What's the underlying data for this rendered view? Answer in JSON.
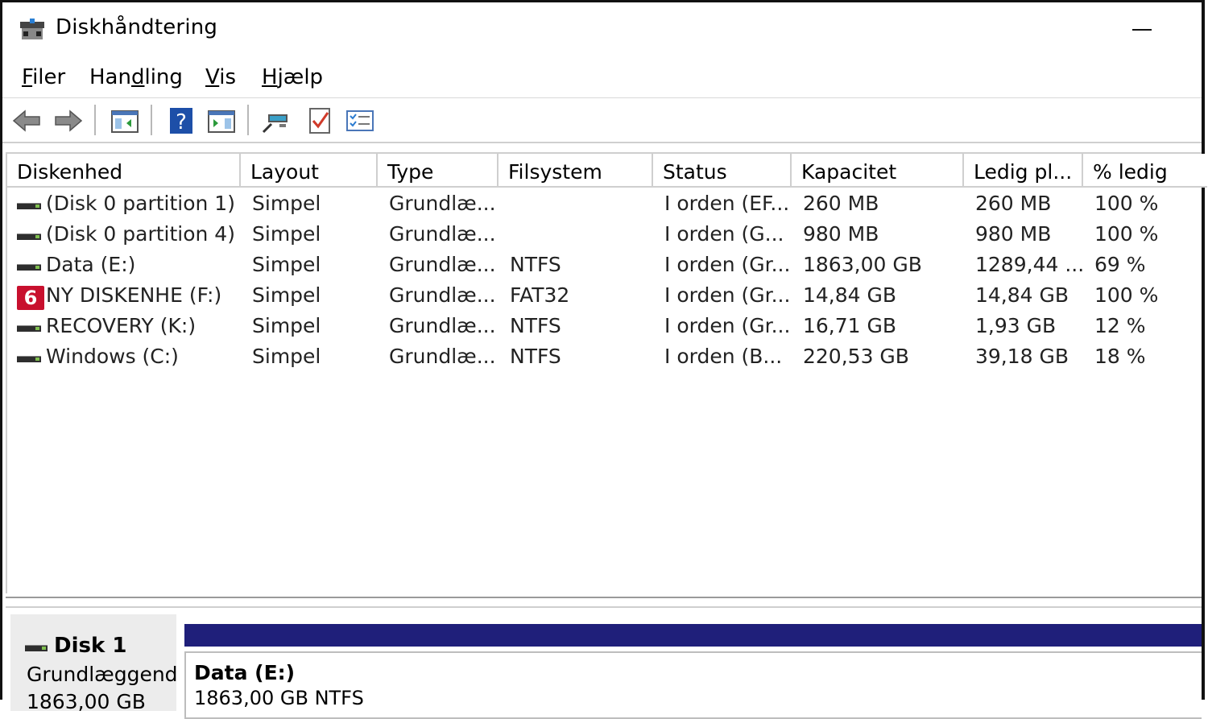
{
  "window": {
    "title": "Diskhåndtering"
  },
  "menu": [
    {
      "label": "Filer",
      "accel": "F",
      "rest": "iler"
    },
    {
      "label": "Handling",
      "pre": "Han",
      "accel": "d",
      "rest": "ling"
    },
    {
      "label": "Vis",
      "accel": "V",
      "rest": "is"
    },
    {
      "label": "Hjælp",
      "accel": "H",
      "rest": "jælp"
    }
  ],
  "toolbar": {
    "buttons": [
      "back-icon",
      "forward-icon",
      "console-tree-icon",
      "help-icon",
      "action-pane-icon",
      "connect-icon",
      "properties-icon",
      "list-icon"
    ]
  },
  "volumes": {
    "columns": [
      "Diskenhed",
      "Layout",
      "Type",
      "Filsystem",
      "Status",
      "Kapacitet",
      "Ledig pl...",
      "% ledig"
    ],
    "rows": [
      {
        "name": "(Disk 0 partition 1)",
        "layout": "Simpel",
        "type": "Grundlæ...",
        "fs": "",
        "status": "I orden (EF...",
        "capacity": "260 MB",
        "free": "260 MB",
        "pct": "100 %"
      },
      {
        "name": "(Disk 0 partition 4)",
        "layout": "Simpel",
        "type": "Grundlæ...",
        "fs": "",
        "status": "I orden (G...",
        "capacity": "980 MB",
        "free": "980 MB",
        "pct": "100 %"
      },
      {
        "name": "Data (E:)",
        "layout": "Simpel",
        "type": "Grundlæ...",
        "fs": "NTFS",
        "status": "I orden (Gr...",
        "capacity": "1863,00 GB",
        "free": "1289,44 ...",
        "pct": "69 %"
      },
      {
        "name": "NY DISKENHE (F:)",
        "badge": "6",
        "layout": "Simpel",
        "type": "Grundlæ...",
        "fs": "FAT32",
        "status": "I orden (Gr...",
        "capacity": "14,84 GB",
        "free": "14,84 GB",
        "pct": "100 %"
      },
      {
        "name": "RECOVERY (K:)",
        "layout": "Simpel",
        "type": "Grundlæ...",
        "fs": "NTFS",
        "status": "I orden (Gr...",
        "capacity": "16,71 GB",
        "free": "1,93 GB",
        "pct": "12 %"
      },
      {
        "name": "Windows (C:)",
        "layout": "Simpel",
        "type": "Grundlæ...",
        "fs": "NTFS",
        "status": "I orden (B...",
        "capacity": "220,53 GB",
        "free": "39,18 GB",
        "pct": "18 %"
      }
    ]
  },
  "disk": {
    "name": "Disk 1",
    "type": "Grundlæggend",
    "size": "1863,00 GB",
    "partition": {
      "name": "Data  (E:)",
      "info": "1863,00 GB NTFS"
    },
    "bar_color": "#1f1f7a"
  },
  "colors": {
    "badge": "#c8102e"
  }
}
